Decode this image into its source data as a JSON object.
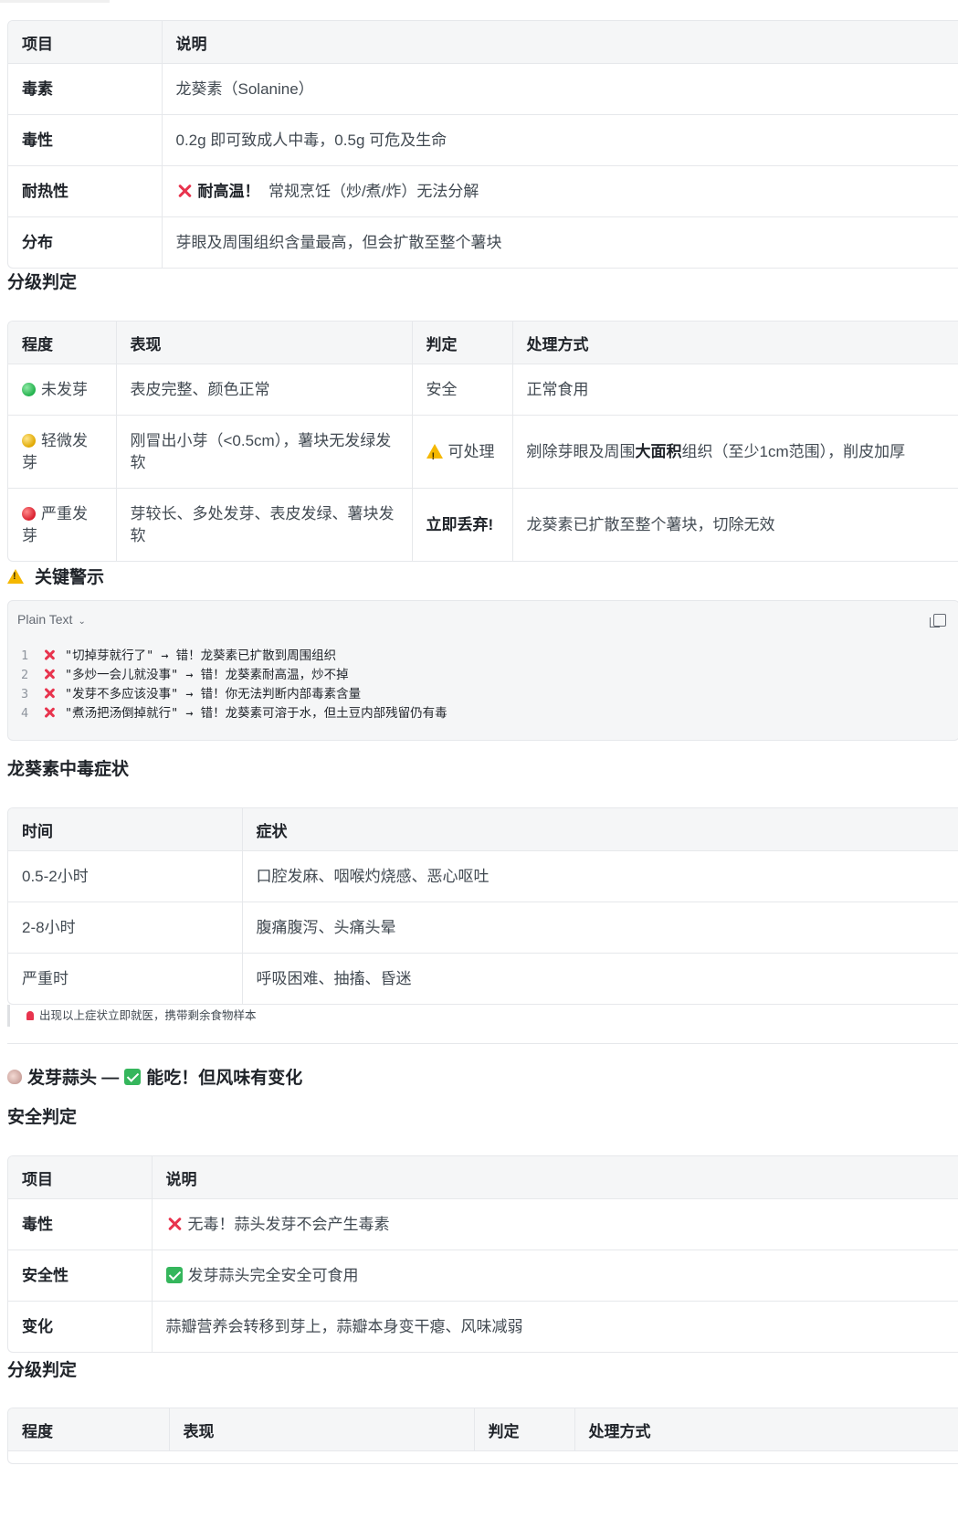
{
  "potato_toxin_table": {
    "headers": [
      "项目",
      "说明"
    ],
    "rows": [
      {
        "key": "毒素",
        "value": "龙葵素（Solanine）"
      },
      {
        "key": "毒性",
        "value": "0.2g 即可致成人中毒，0.5g 可危及生命"
      },
      {
        "key": "耐热性",
        "value_strong": "耐高温！",
        "value": "常规烹饪（炒/煮/炸）无法分解"
      },
      {
        "key": "分布",
        "value": "芽眼及周围组织含量最高，但会扩散至整个薯块"
      }
    ]
  },
  "potato_grading": {
    "title": "分级判定",
    "headers": [
      "程度",
      "表现",
      "判定",
      "处理方式"
    ],
    "rows": [
      {
        "level": "未发芽",
        "sign": "表皮完整、颜色正常",
        "verdict": "安全",
        "action": "正常食用"
      },
      {
        "level": "轻微发芽",
        "sign": "刚冒出小芽（<0.5cm），薯块无发绿发软",
        "verdict": "可处理",
        "action_pre": "剜除芽眼及周围",
        "action_strong": "大面积",
        "action_post": "组织（至少1cm范围），削皮加厚"
      },
      {
        "level": "严重发芽",
        "sign": "芽较长、多处发芽、表皮发绿、薯块发软",
        "verdict": "立即丢弃!",
        "action": "龙葵素已扩散至整个薯块，切除无效"
      }
    ]
  },
  "key_warning": {
    "title": "关键警示",
    "code_lang": "Plain Text",
    "lines": [
      {
        "n": "1",
        "text": "\"切掉芽就行了\" → 错！龙葵素已扩散到周围组织"
      },
      {
        "n": "2",
        "text": "\"多炒一会儿就没事\" → 错！龙葵素耐高温，炒不掉"
      },
      {
        "n": "3",
        "text": "\"发芽不多应该没事\" → 错！你无法判断内部毒素含量"
      },
      {
        "n": "4",
        "text": "\"煮汤把汤倒掉就行\" → 错！龙葵素可溶于水，但土豆内部残留仍有毒"
      }
    ]
  },
  "symptoms": {
    "title": "龙葵素中毒症状",
    "headers": [
      "时间",
      "症状"
    ],
    "rows": [
      {
        "time": "0.5-2小时",
        "symptom": "口腔发麻、咽喉灼烧感、恶心呕吐"
      },
      {
        "time": "2-8小时",
        "symptom": "腹痛腹泻、头痛头晕"
      },
      {
        "time": "严重时",
        "symptom": "呼吸困难、抽搐、昏迷"
      }
    ],
    "note": "出现以上症状立即就医，携带剩余食物样本"
  },
  "garlic": {
    "heading_a": "发芽蒜头 —",
    "heading_b": "能吃！但风味有变化",
    "safety_title": "安全判定",
    "headers": [
      "项目",
      "说明"
    ],
    "rows": [
      {
        "key": "毒性",
        "value": "无毒！蒜头发芽不会产生毒素"
      },
      {
        "key": "安全性",
        "value": "发芽蒜头完全安全可食用"
      },
      {
        "key": "变化",
        "value": "蒜瓣营养会转移到芽上，蒜瓣本身变干瘪、风味减弱"
      }
    ],
    "grading_title": "分级判定",
    "grading_headers": [
      "程度",
      "表现",
      "判定",
      "处理方式"
    ]
  },
  "colors": {
    "accent_red": "#e8344e",
    "accent_green": "#35b65c",
    "warn_yellow": "#f5b800"
  }
}
